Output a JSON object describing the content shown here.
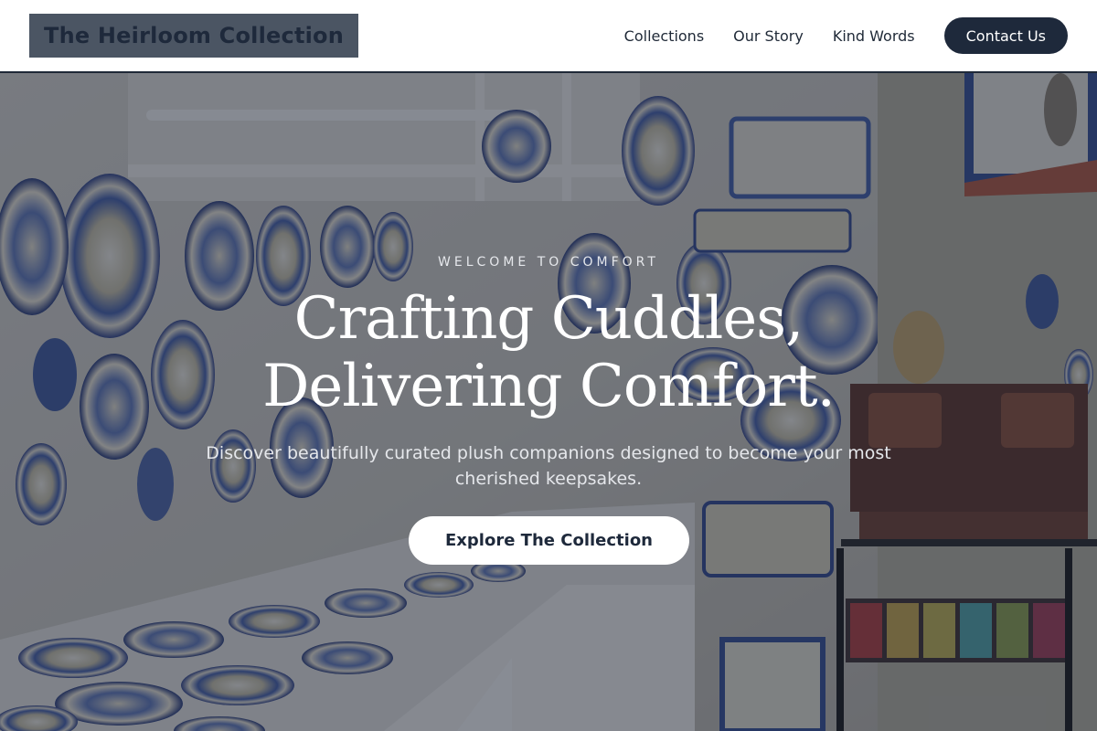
{
  "header": {
    "logo": "The Heirloom Collection",
    "nav": [
      "Collections",
      "Our Story",
      "Kind Words"
    ],
    "cta": "Contact Us"
  },
  "hero": {
    "eyebrow": "WELCOME TO COMFORT",
    "headline": "Crafting Cuddles, Delivering Comfort.",
    "subheadline": "Discover beautifully curated plush companions designed to become your most cherished keepsakes.",
    "button": "Explore The Collection"
  },
  "colors": {
    "brand_dark": "#1e293b",
    "logo_background": "#4b5563",
    "overlay": "rgba(30,38,56,0.52)",
    "background_white": "#ffffff"
  }
}
